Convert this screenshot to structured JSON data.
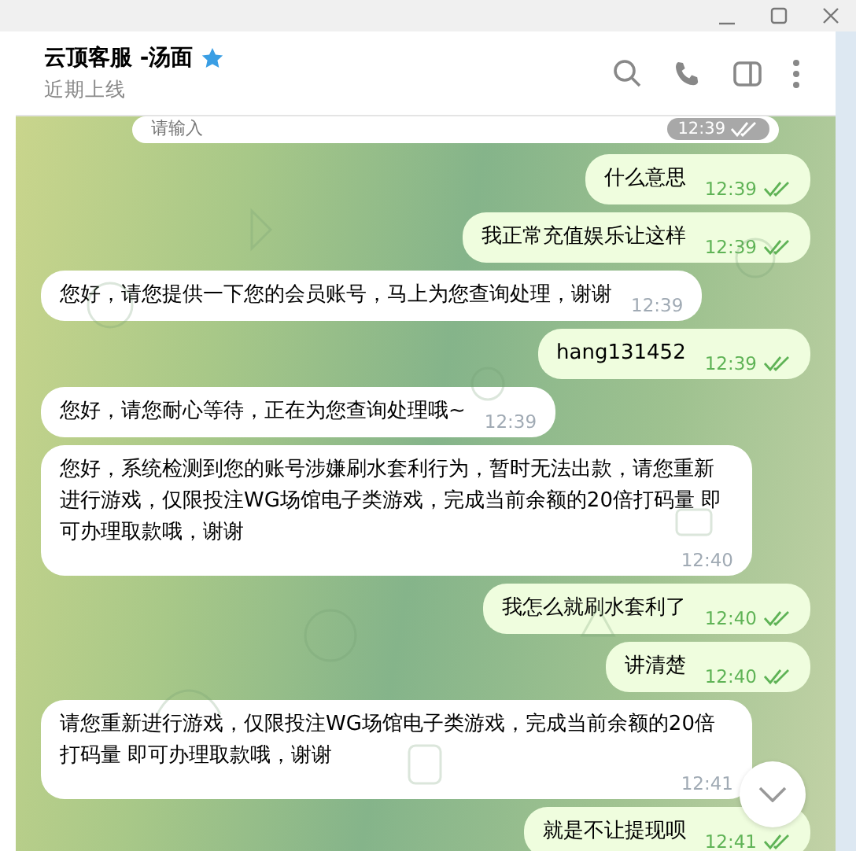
{
  "window": {
    "controls": [
      {
        "kind": "minimize"
      },
      {
        "kind": "maximize"
      },
      {
        "kind": "close"
      }
    ]
  },
  "chat_header": {
    "title": "云顶客服 -汤面",
    "verified": true,
    "status": "近期上线",
    "actions": [
      {
        "kind": "search"
      },
      {
        "kind": "call"
      },
      {
        "kind": "sidebar"
      },
      {
        "kind": "more"
      }
    ]
  },
  "messages": [
    {
      "kind": "partial",
      "text": "请输入",
      "time": "12:39",
      "read": true
    },
    {
      "kind": "outgoing",
      "text": "什么意思",
      "time": "12:39",
      "read": true
    },
    {
      "kind": "outgoing",
      "text": "我正常充值娱乐让这样",
      "time": "12:39",
      "read": true
    },
    {
      "kind": "incoming",
      "text": "您好，请您提供一下您的会员账号，马上为您查询处理，谢谢",
      "time": "12:39"
    },
    {
      "kind": "outgoing",
      "text": "hang131452",
      "time": "12:39",
      "read": true
    },
    {
      "kind": "incoming",
      "text": "您好，请您耐心等待，正在为您查询处理哦~",
      "time": "12:39"
    },
    {
      "kind": "incoming",
      "text": "您好，系统检测到您的账号涉嫌刷水套利行为，暂时无法出款，请您重新进行游戏，仅限投注WG场馆电子类游戏，完成当前余额的20倍打码量 即可办理取款哦，谢谢",
      "time": "12:40"
    },
    {
      "kind": "outgoing",
      "text": "我怎么就刷水套利了",
      "time": "12:40",
      "read": true
    },
    {
      "kind": "outgoing",
      "text": "讲清楚",
      "time": "12:40",
      "read": true
    },
    {
      "kind": "incoming",
      "text": "请您重新进行游戏，仅限投注WG场馆电子类游戏，完成当前余额的20倍打码量 即可办理取款哦，谢谢",
      "time": "12:41"
    },
    {
      "kind": "outgoing",
      "text": "就是不让提现呗",
      "time": "12:41",
      "read": true
    }
  ],
  "scroll_down_button": {
    "visible": true
  }
}
